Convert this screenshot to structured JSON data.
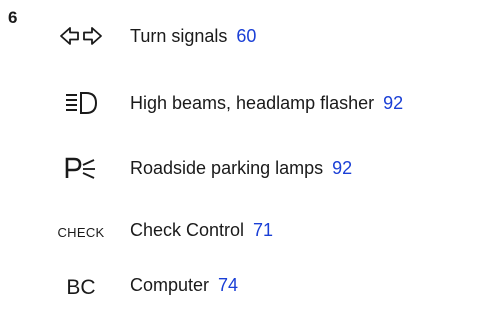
{
  "section_number": "6",
  "items": [
    {
      "icon": "turn-signal-arrows-icon",
      "label": "Turn signals",
      "page": "60"
    },
    {
      "icon": "high-beam-headlamp-icon",
      "label": "High beams, headlamp flasher",
      "page": "92"
    },
    {
      "icon": "parking-lamp-icon",
      "label": "Roadside parking lamps",
      "page": "92"
    },
    {
      "icon": "check-control-icon",
      "icon_text": "CHECK",
      "label": "Check Control",
      "page": "71"
    },
    {
      "icon": "computer-icon",
      "icon_text": "BC",
      "label": "Computer",
      "page": "74"
    }
  ],
  "colors": {
    "text": "#1a1a1a",
    "page_link": "#1a3fd6"
  }
}
